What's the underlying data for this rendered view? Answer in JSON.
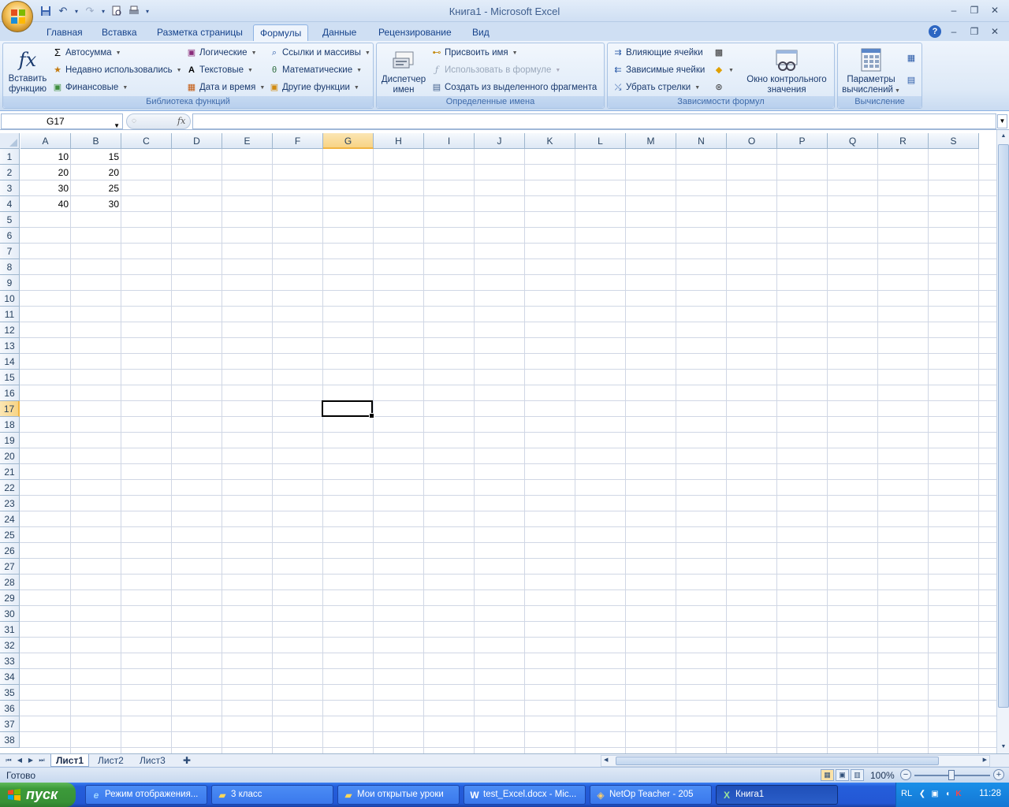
{
  "window": {
    "title": "Книга1 - Microsoft Excel",
    "controls": {
      "minimize": "–",
      "restore": "❐",
      "close": "✕"
    }
  },
  "ribbon_tabs": [
    {
      "label": "Главная"
    },
    {
      "label": "Вставка"
    },
    {
      "label": "Разметка страницы"
    },
    {
      "label": "Формулы",
      "active": true
    },
    {
      "label": "Данные"
    },
    {
      "label": "Рецензирование"
    },
    {
      "label": "Вид"
    }
  ],
  "ribbon": {
    "library": {
      "label": "Библиотека функций",
      "insert_function": [
        "Вставить",
        "функцию"
      ],
      "autosum": "Автосумма",
      "recent": "Недавно использовались",
      "financial": "Финансовые",
      "logical": "Логические",
      "text": "Текстовые",
      "datetime": "Дата и время",
      "lookup": "Ссылки и массивы",
      "math": "Математические",
      "other": "Другие функции"
    },
    "names": {
      "label": "Определенные имена",
      "manager": [
        "Диспетчер",
        "имен"
      ],
      "assign": "Присвоить имя",
      "use_in_formula": "Использовать в формуле",
      "create_from_selection": "Создать из выделенного фрагмента"
    },
    "audit": {
      "label": "Зависимости формул",
      "precedents": "Влияющие ячейки",
      "dependents": "Зависимые ячейки",
      "remove_arrows": "Убрать стрелки",
      "watch_window": [
        "Окно контрольного",
        "значения"
      ]
    },
    "calc": {
      "label": "Вычисление",
      "options": [
        "Параметры",
        "вычислений"
      ]
    }
  },
  "formula_bar": {
    "name_box": "G17",
    "fx": "fx",
    "formula": ""
  },
  "sheet": {
    "columns": [
      "A",
      "B",
      "C",
      "D",
      "E",
      "F",
      "G",
      "H",
      "I",
      "J",
      "K",
      "L",
      "M",
      "N",
      "O",
      "P",
      "Q",
      "R",
      "S"
    ],
    "selected_column": "G",
    "selected_row": 17,
    "active_cell": "G17",
    "rows": [
      "1",
      "2",
      "3",
      "4",
      "5",
      "6",
      "7",
      "8",
      "9",
      "10",
      "11",
      "12",
      "13",
      "14",
      "15",
      "16",
      "17",
      "18",
      "19",
      "20",
      "21",
      "22",
      "23",
      "24",
      "25",
      "26",
      "27",
      "28",
      "29",
      "30",
      "31",
      "32",
      "33",
      "34",
      "35",
      "36",
      "37",
      "38"
    ],
    "cells": [
      {
        "ref": "A1",
        "value": "10"
      },
      {
        "ref": "B1",
        "value": "15"
      },
      {
        "ref": "A2",
        "value": "20"
      },
      {
        "ref": "B2",
        "value": "20"
      },
      {
        "ref": "A3",
        "value": "30"
      },
      {
        "ref": "B3",
        "value": "25"
      },
      {
        "ref": "A4",
        "value": "40"
      },
      {
        "ref": "B4",
        "value": "30"
      }
    ]
  },
  "sheet_tabs": [
    {
      "label": "Лист1",
      "active": true
    },
    {
      "label": "Лист2"
    },
    {
      "label": "Лист3"
    }
  ],
  "status": {
    "text": "Готово",
    "zoom": "100%"
  },
  "taskbar": {
    "start_label": "пуск",
    "tasks": [
      {
        "label": "Режим отображения...",
        "icon": "ie-icon"
      },
      {
        "label": "3 класс",
        "icon": "folder-icon"
      },
      {
        "label": "Мои открытые уроки",
        "icon": "folder-icon"
      },
      {
        "label": "test_Excel.docx - Mic...",
        "icon": "word-icon"
      },
      {
        "label": "NetOp Teacher - 205",
        "icon": "netop-icon"
      },
      {
        "label": "Книга1",
        "icon": "excel-icon",
        "active": true
      }
    ],
    "language": "RL",
    "clock": "11:28"
  },
  "colors": {
    "accent": "#15428b",
    "selected_header": "#f8d485",
    "gridline": "#d0d7e5",
    "taskbar": "#245edb",
    "start_button": "#3c9a3a"
  }
}
